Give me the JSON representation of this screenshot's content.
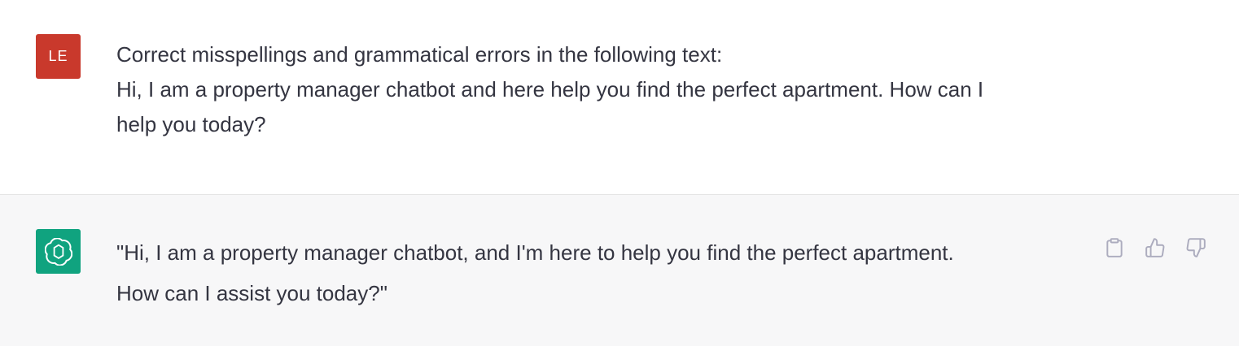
{
  "conversation": {
    "user_message": {
      "avatar_initials": "LE",
      "avatar_color": "#c9392c",
      "lines": [
        "Correct misspellings and grammatical errors in the following text:",
        "Hi, I am a property manager chatbot and here help you find the perfect apartment. How can I",
        "help you today?"
      ]
    },
    "assistant_message": {
      "avatar_icon": "openai-logo-icon",
      "avatar_color": "#10a37f",
      "lines": [
        "\"Hi, I am a property manager chatbot, and I'm here to help you find the perfect apartment.",
        "How can I assist you today?\""
      ],
      "actions": [
        {
          "icon": "clipboard-icon"
        },
        {
          "icon": "thumbs-up-icon"
        },
        {
          "icon": "thumbs-down-icon"
        }
      ]
    }
  }
}
